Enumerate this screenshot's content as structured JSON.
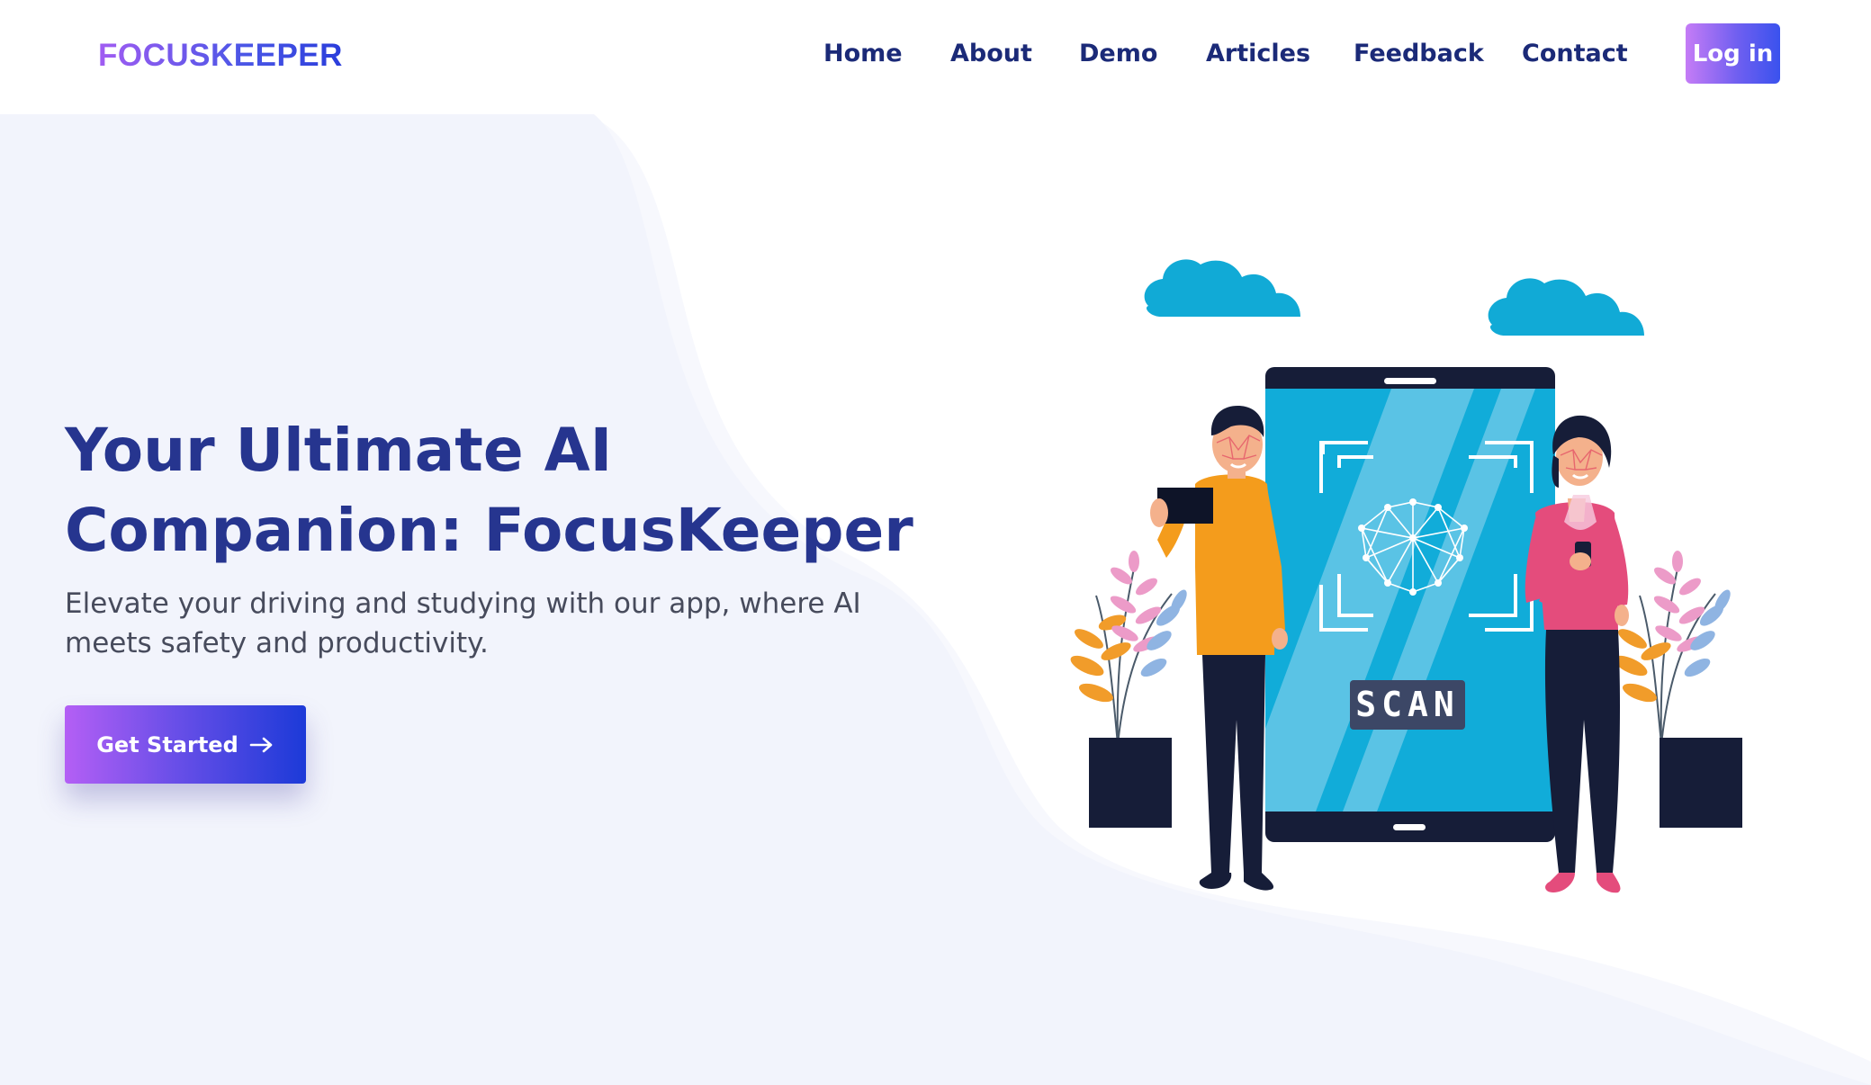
{
  "brand": {
    "name": "FOCUSKEEPER"
  },
  "nav": {
    "items": [
      {
        "label": "Home"
      },
      {
        "label": "About"
      },
      {
        "label": "Demo"
      },
      {
        "label": "Articles"
      },
      {
        "label": "Feedback"
      },
      {
        "label": "Contact"
      }
    ],
    "login_label": "Log in"
  },
  "hero": {
    "title_lines": [
      "Your Ultimate AI",
      "Companion: FocusKeeper"
    ],
    "subtitle_lines": [
      "Elevate your driving and studying with our app, where AI",
      "meets safety and productivity."
    ],
    "cta_label": "Get Started",
    "cta_icon": "arrow-right-icon"
  },
  "illustration": {
    "scan_label": "SCAN"
  },
  "colors": {
    "heading": "#26358f",
    "nav_text": "#1b2a78",
    "brand_gradient_start": "#a15cf2",
    "brand_gradient_end": "#2a3ddb",
    "hero_background": "#f2f4fc"
  }
}
